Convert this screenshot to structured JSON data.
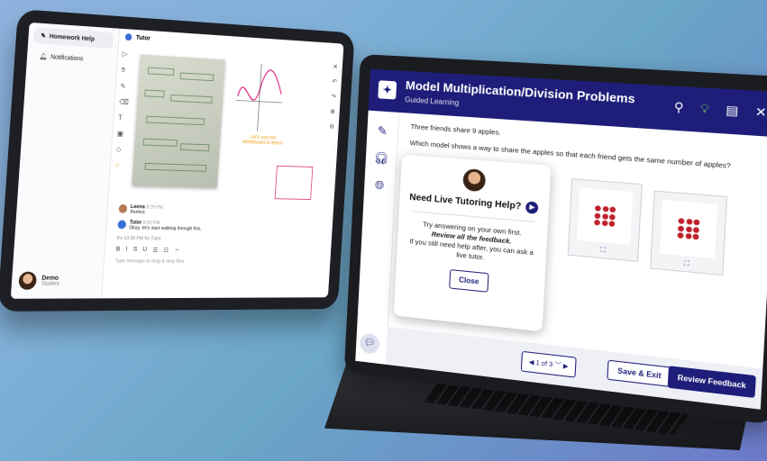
{
  "tablet": {
    "sidebar": {
      "items": [
        {
          "label": "Homework Help",
          "active": true
        },
        {
          "label": "Notifications",
          "active": false
        }
      ],
      "user": {
        "name": "Demo",
        "role": "Student"
      }
    },
    "header": {
      "title": "Tutor"
    },
    "whiteboard_text": "Let's use the whiteboard to learn!",
    "chat": [
      {
        "sender": "Leena",
        "time": "8:29 PM",
        "text": "Perfect."
      },
      {
        "sender": "Tutor",
        "time": "8:30 PM",
        "text": "Okay, let's start walking through this."
      }
    ],
    "note": "It's 10:30 PM for Tutor",
    "format": [
      "B",
      "I",
      "S",
      "U",
      "☰",
      "☷",
      "⇔"
    ],
    "input_placeholder": "Type message or drag & drop files"
  },
  "laptop": {
    "header": {
      "title": "Model Multiplication/Division Problems",
      "subtitle": "Guided Learning"
    },
    "question": {
      "line1": "Three friends share 9 apples.",
      "line2": "Which model shows a way to share the apples so that each friend gets the same number of apples?"
    },
    "modal": {
      "title": "Need Live Tutoring Help?",
      "line1": "Try answering on your own first.",
      "line2": "Review all the feedback.",
      "line3": "If you still need help after, you can ask a live tutor.",
      "close": "Close"
    },
    "pager": "1 of 3",
    "buttons": {
      "save": "Save & Exit",
      "review": "Review Feedback"
    }
  }
}
